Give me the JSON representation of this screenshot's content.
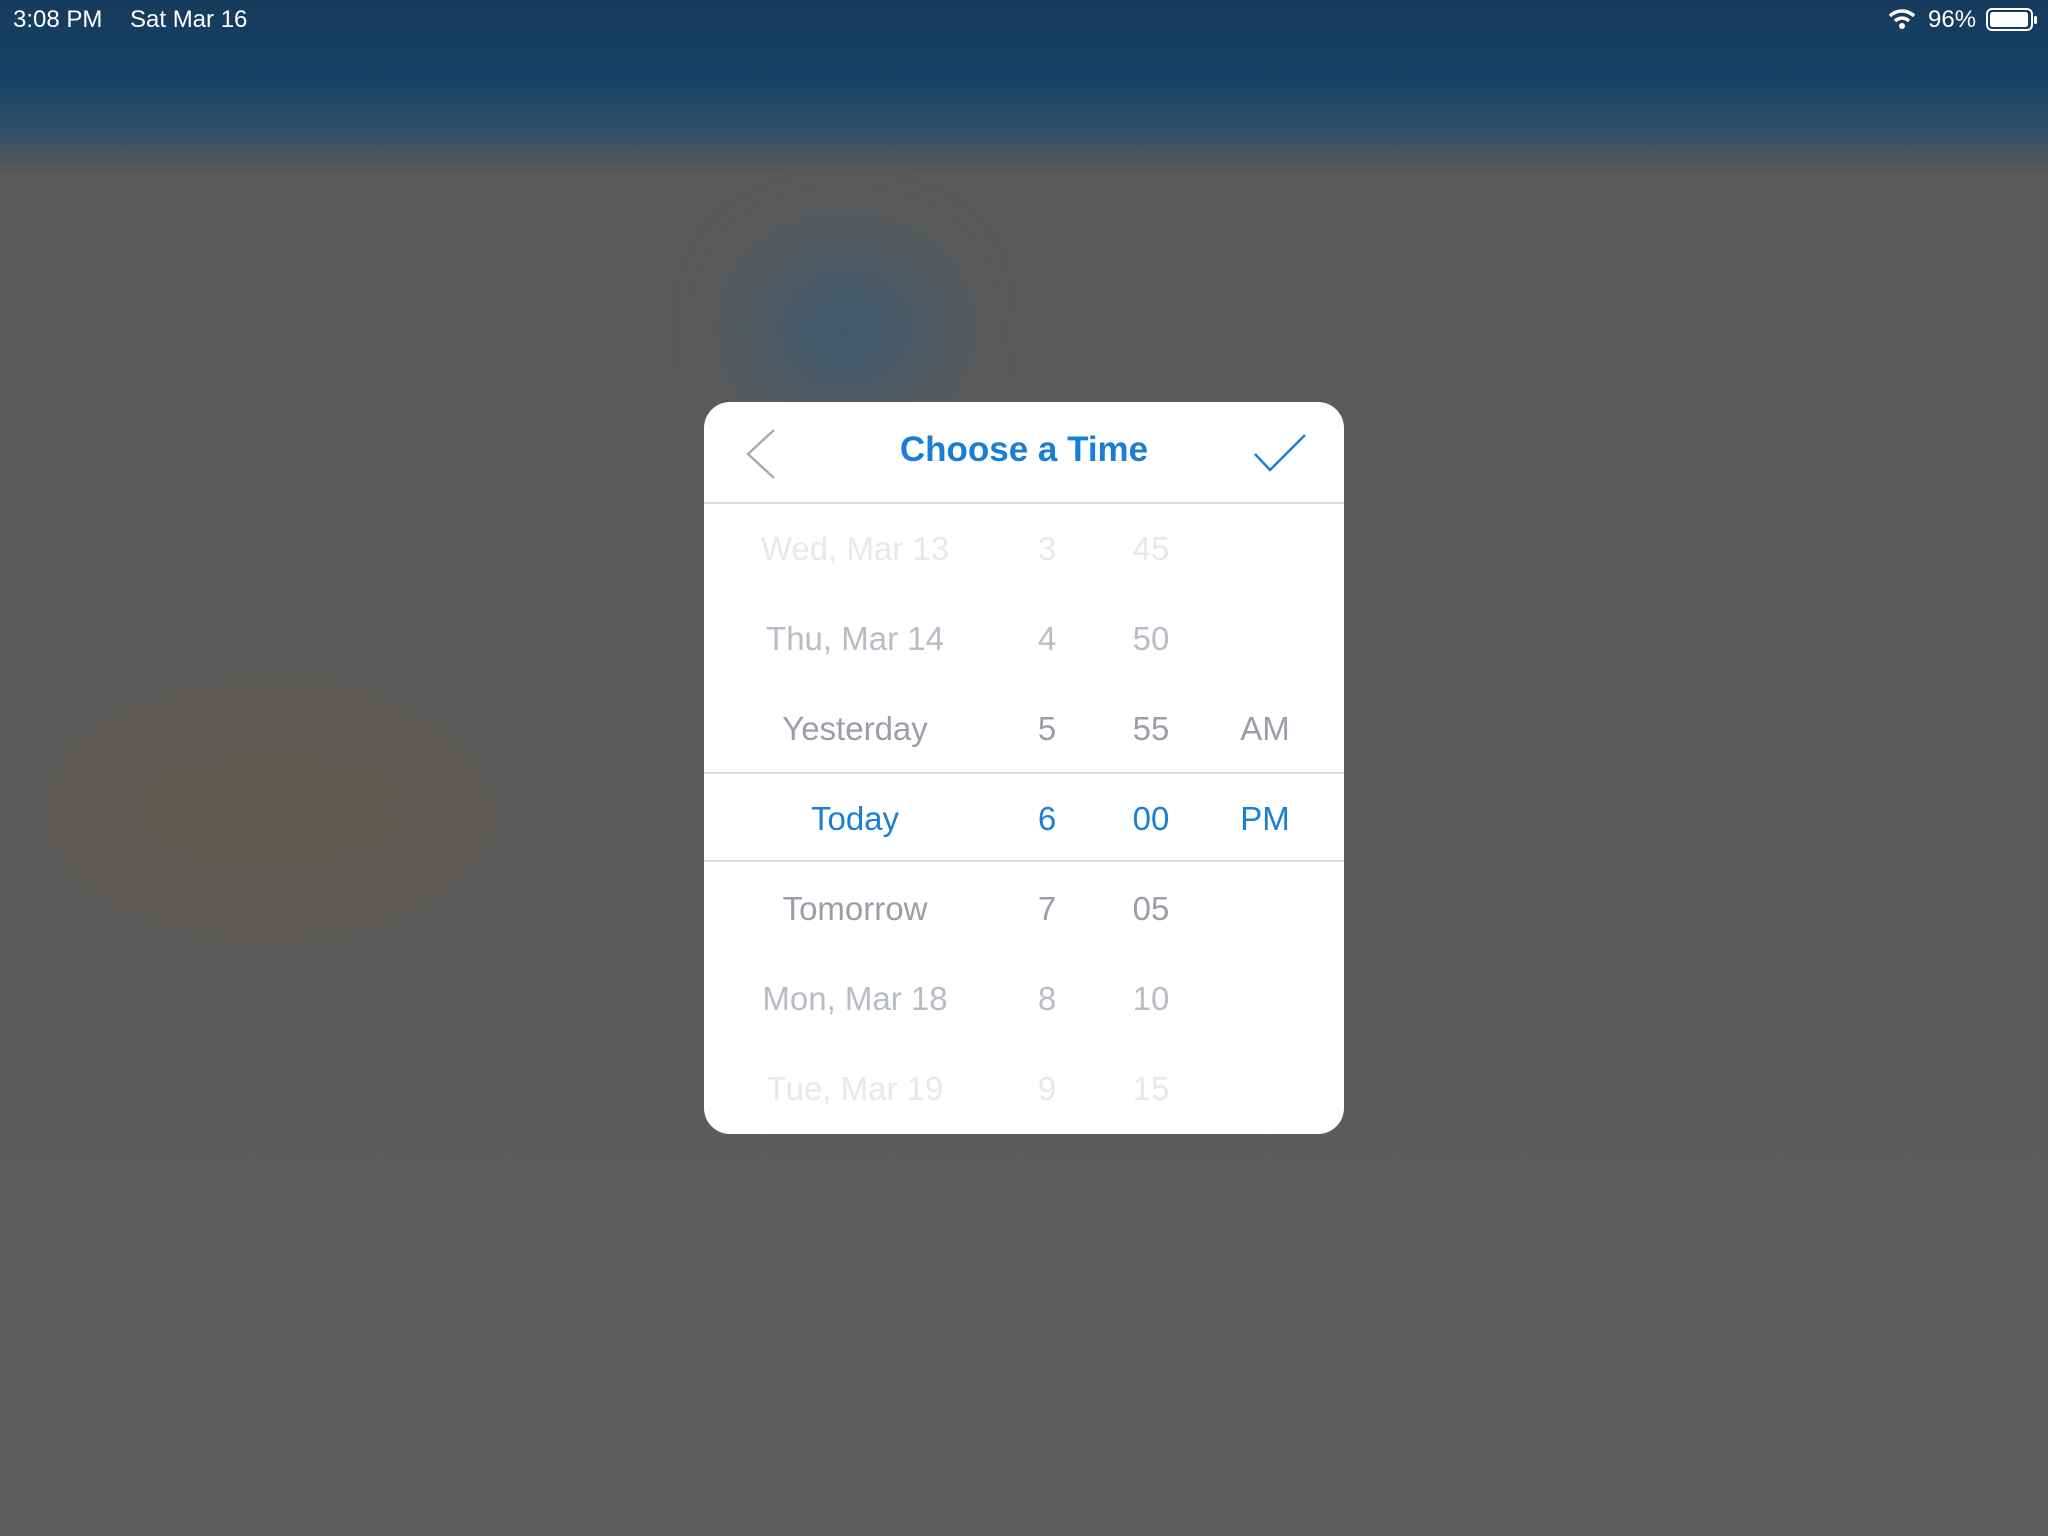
{
  "status_bar": {
    "time": "3:08 PM",
    "date": "Sat Mar 16",
    "battery": "96%",
    "icons": [
      "wifi-icon",
      "battery-icon"
    ]
  },
  "dialog": {
    "title": "Choose a Time",
    "back_icon": "chevron-left-icon",
    "confirm_icon": "checkmark-icon",
    "accent_color": "#1a7fd4",
    "day_column": [
      "Wed, Mar 13",
      "Thu, Mar 14",
      "Yesterday",
      "Today",
      "Tomorrow",
      "Mon, Mar 18",
      "Tue, Mar 19"
    ],
    "hour_column": [
      "3",
      "4",
      "5",
      "6",
      "7",
      "8",
      "9"
    ],
    "minute_column": [
      "45",
      "50",
      "55",
      "00",
      "05",
      "10",
      "15"
    ],
    "period_column": [
      "AM",
      "PM"
    ],
    "selected": {
      "day": "Today",
      "hour": "6",
      "minute": "00",
      "period": "PM"
    }
  }
}
